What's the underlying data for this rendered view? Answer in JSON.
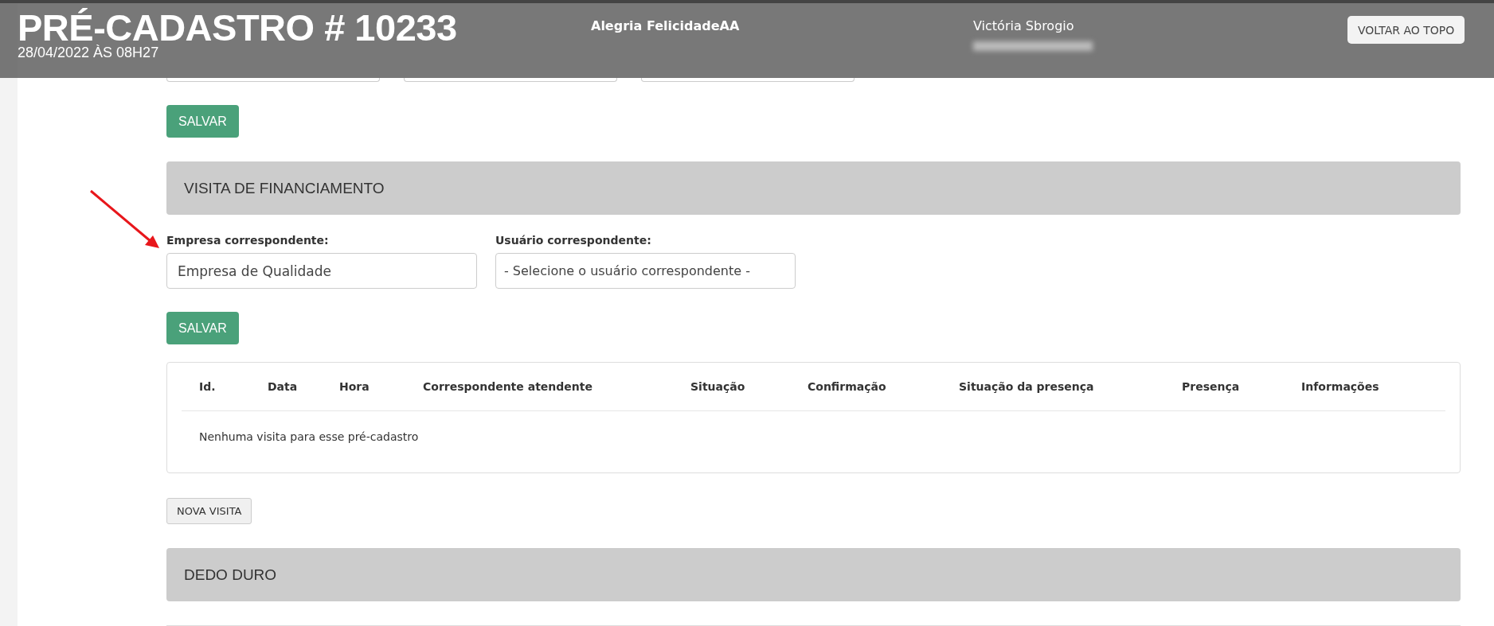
{
  "header": {
    "title": "PRÉ-CADASTRO # 10233",
    "subtitle": "28/04/2022 ÀS 08H27",
    "client_name": "Alegria FelicidadeAA",
    "user_name": "Victória Sbrogio",
    "top_button": "VOLTAR AO TOPO"
  },
  "top_form": {
    "save_button": "SALVAR"
  },
  "sections": [
    {
      "title": "VISITA DE FINANCIAMENTO"
    },
    {
      "title": "DEDO DURO"
    }
  ],
  "visit_form": {
    "company": {
      "label": "Empresa correspondente:",
      "value": "Empresa de Qualidade"
    },
    "user": {
      "label": "Usuário correspondente:",
      "value": "- Selecione o usuário correspondente -"
    },
    "save_button": "SALVAR"
  },
  "table": {
    "columns": [
      "Id.",
      "Data",
      "Hora",
      "Correspondente atendente",
      "Situação",
      "Confirmação",
      "Situação da presença",
      "Presença",
      "Informações"
    ],
    "empty_message": "Nenhuma visita para esse pré-cadastro"
  },
  "new_visit_button": "NOVA VISITA"
}
